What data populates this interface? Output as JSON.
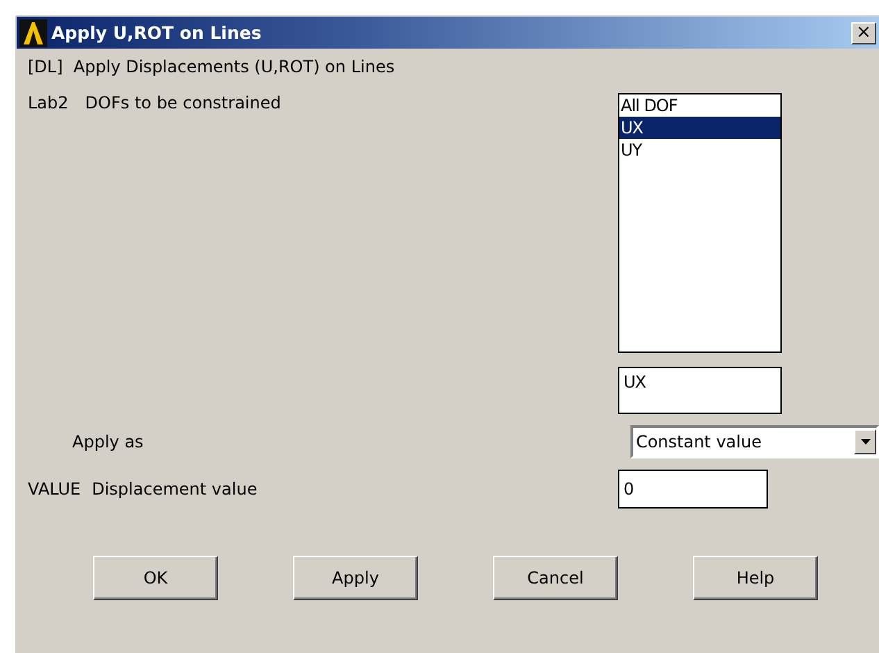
{
  "window": {
    "title": "Apply U,ROT on Lines",
    "close": "×"
  },
  "heading": "[DL]  Apply Displacements (U,ROT) on Lines",
  "dofs": {
    "code": "Lab2",
    "label": "DOFs to be constrained",
    "options": [
      {
        "label": "All DOF",
        "selected": false
      },
      {
        "label": "UX",
        "selected": true
      },
      {
        "label": "UY",
        "selected": false
      }
    ],
    "value": "UX"
  },
  "apply_as": {
    "label": "Apply as",
    "value": "Constant value"
  },
  "value": {
    "code": "VALUE",
    "label": "Displacement value",
    "value": "0"
  },
  "buttons": [
    "OK",
    "Apply",
    "Cancel",
    "Help"
  ]
}
